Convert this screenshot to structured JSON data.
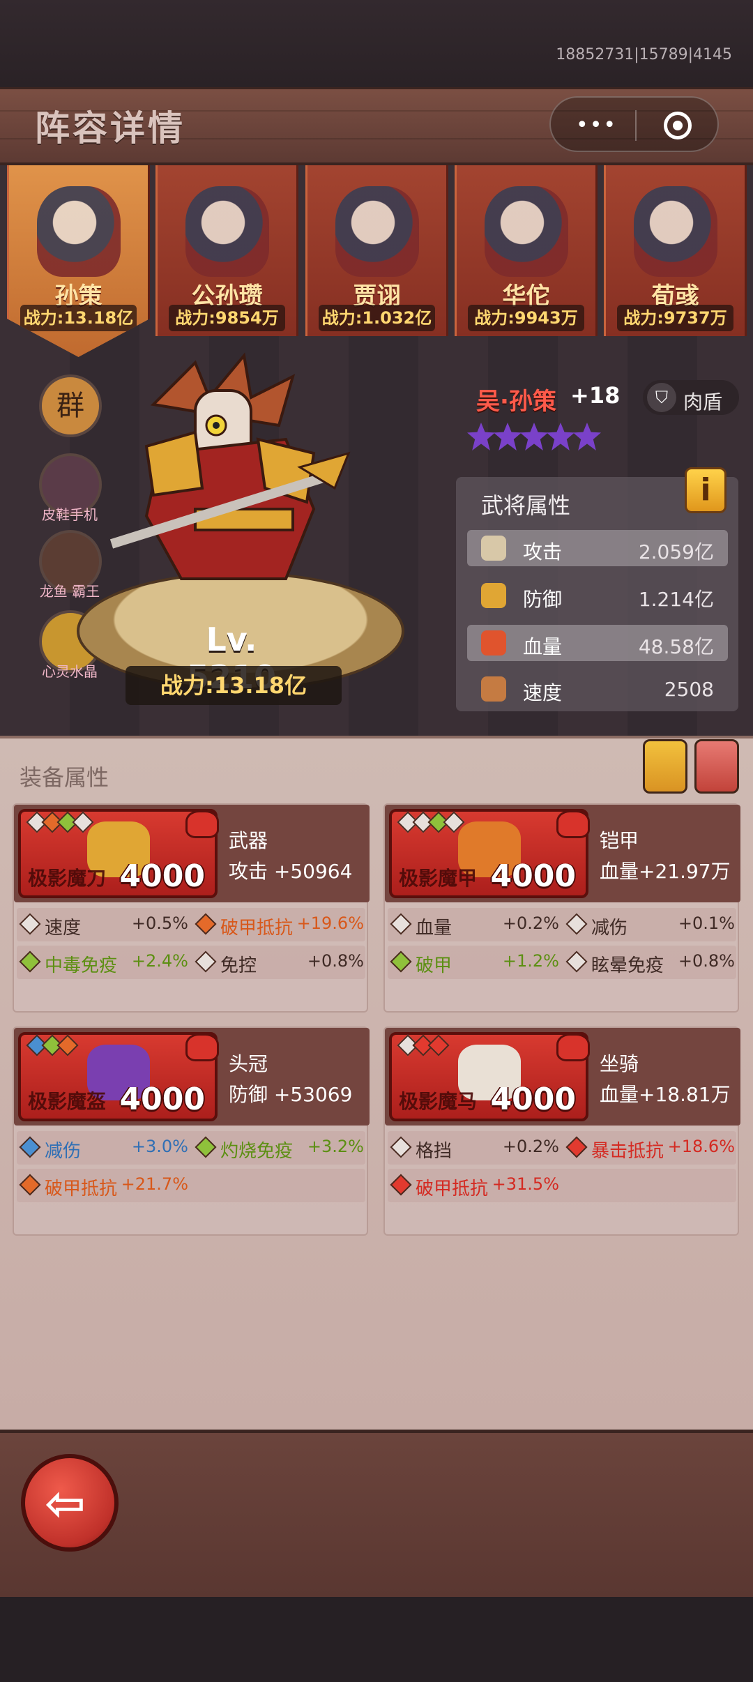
{
  "status": {
    "id_text": "18852731|15789|4145"
  },
  "header": {
    "title": "阵容详情",
    "more_icon": "more-dots-icon",
    "close_icon": "target-circle-icon"
  },
  "team": [
    {
      "name": "孙策",
      "power": "战力:13.18亿",
      "selected": true
    },
    {
      "name": "公孙瓒",
      "power": "战力:9854万",
      "selected": false
    },
    {
      "name": "贾诩",
      "power": "战力:1.032亿",
      "selected": false
    },
    {
      "name": "华佗",
      "power": "战力:9943万",
      "selected": false
    },
    {
      "name": "荀彧",
      "power": "战力:9737万",
      "selected": false
    }
  ],
  "side_icons": [
    {
      "label": "",
      "glyph": "群",
      "color": "#c9893e"
    },
    {
      "label": "皮鞋手机",
      "glyph": "",
      "color": "#5a3b48"
    },
    {
      "label": "龙鱼 霸王",
      "glyph": "",
      "color": "#5b3d33"
    },
    {
      "label": "心灵水晶",
      "glyph": "",
      "color": "#c8962f"
    }
  ],
  "hero": {
    "level": "Lv. 5210",
    "power": "战力:13.18亿",
    "name": "吴·孙策",
    "plus": "+18",
    "role": "肉盾",
    "stars": 5
  },
  "attributes": {
    "title": "武将属性",
    "info_label": "i",
    "rows": [
      {
        "name": "攻击",
        "value": "2.059亿",
        "color": "#d8c8a8",
        "highlight": true
      },
      {
        "name": "防御",
        "value": "1.214亿",
        "color": "#e0a634",
        "highlight": false
      },
      {
        "name": "血量",
        "value": "48.58亿",
        "color": "#e0542d",
        "highlight": true
      },
      {
        "name": "速度",
        "value": "2508",
        "color": "#c57b42",
        "highlight": false
      }
    ]
  },
  "equipment": {
    "title": "装备属性",
    "items": [
      {
        "name": "极影魔刀",
        "level": "4000",
        "type": "武器",
        "main": "攻击   +50964",
        "gems": [
          "#e7e0dc",
          "#e46a2a",
          "#8fc13b",
          "#e7e0dc"
        ],
        "subs": [
          [
            {
              "name": "速度",
              "value": "+0.5%",
              "color": "#e7e0dc",
              "text": "#3f2a25"
            },
            {
              "name": "破甲抵抗",
              "value": "+19.6%",
              "color": "#e46a2a",
              "text": "#d8581a"
            }
          ],
          [
            {
              "name": "中毒免疫",
              "value": "+2.4%",
              "color": "#8fc13b",
              "text": "#5c8f12"
            },
            {
              "name": "免控",
              "value": "+0.8%",
              "color": "#e7e0dc",
              "text": "#3f2a25"
            }
          ]
        ]
      },
      {
        "name": "极影魔甲",
        "level": "4000",
        "type": "铠甲",
        "main": "血量+21.97万",
        "gems": [
          "#e7e0dc",
          "#e7e0dc",
          "#8fc13b",
          "#e7e0dc"
        ],
        "subs": [
          [
            {
              "name": "血量",
              "value": "+0.2%",
              "color": "#e7e0dc",
              "text": "#3f2a25"
            },
            {
              "name": "减伤",
              "value": "+0.1%",
              "color": "#e7e0dc",
              "text": "#3f2a25"
            }
          ],
          [
            {
              "name": "破甲",
              "value": "+1.2%",
              "color": "#8fc13b",
              "text": "#5c8f12"
            },
            {
              "name": "眩晕免疫",
              "value": "+0.8%",
              "color": "#e7e0dc",
              "text": "#3f2a25"
            }
          ]
        ]
      },
      {
        "name": "极影魔盔",
        "level": "4000",
        "type": "头冠",
        "main": "防御   +53069",
        "gems": [
          "#4a8fd1",
          "#8fc13b",
          "#e46a2a"
        ],
        "subs": [
          [
            {
              "name": "减伤",
              "value": "+3.0%",
              "color": "#4a8fd1",
              "text": "#2f6fb5"
            },
            {
              "name": "灼烧免疫",
              "value": "+3.2%",
              "color": "#8fc13b",
              "text": "#5c8f12"
            }
          ],
          [
            {
              "name": "破甲抵抗",
              "value": "+21.7%",
              "color": "#e46a2a",
              "text": "#d8581a"
            }
          ]
        ]
      },
      {
        "name": "极影魔马",
        "level": "4000",
        "type": "坐骑",
        "main": "血量+18.81万",
        "gems": [
          "#e7e0dc",
          "#e23a2f",
          "#e23a2f"
        ],
        "subs": [
          [
            {
              "name": "格挡",
              "value": "+0.2%",
              "color": "#e7e0dc",
              "text": "#3f2a25"
            },
            {
              "name": "暴击抵抗",
              "value": "+18.6%",
              "color": "#e23a2f",
              "text": "#d42a22"
            }
          ],
          [
            {
              "name": "破甲抵抗",
              "value": "+31.5%",
              "color": "#e23a2f",
              "text": "#d42a22"
            }
          ]
        ]
      }
    ]
  },
  "footer": {
    "back_icon": "back-arrow-icon"
  }
}
